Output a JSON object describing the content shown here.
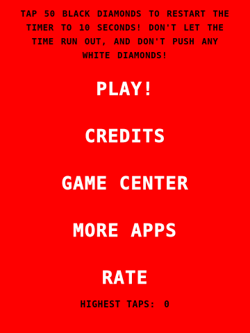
{
  "colors": {
    "background": "#fe0000",
    "instruction_text": "#000000",
    "menu_text": "#ffffff",
    "score_text": "#000000"
  },
  "instructions": {
    "line1": "TAP 50 BLACK DIAMONDS TO RESTART THE",
    "line2": "TIMER TO 10 SECONDS! DON'T LET THE",
    "line3": "TIME RUN OUT, AND DON'T PUSH ANY",
    "line4": "WHITE DIAMONDS!"
  },
  "menu": {
    "play": "PLAY!",
    "credits": "CREDITS",
    "game_center": "GAME CENTER",
    "more_apps": "MORE APPS",
    "rate": "RATE"
  },
  "score": {
    "label": "HIGHEST TAPS:",
    "value": "0"
  }
}
